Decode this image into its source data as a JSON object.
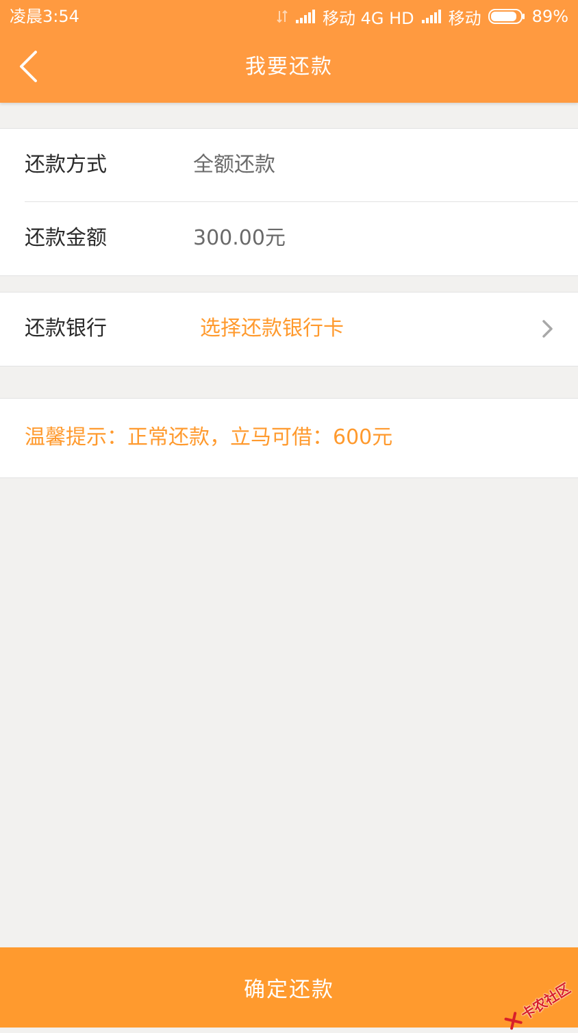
{
  "status_bar": {
    "time": "凌晨3:54",
    "carrier1": "移动 4G HD",
    "carrier2": "移动",
    "battery": "89%",
    "battery_level": 0.89
  },
  "header": {
    "title": "我要还款",
    "back_icon": "chevron-left-icon"
  },
  "repay_info": {
    "method_label": "还款方式",
    "method_value": "全额还款",
    "amount_label": "还款金额",
    "amount_value": "300.00元"
  },
  "bank": {
    "label": "还款银行",
    "placeholder": "选择还款银行卡",
    "arrow_icon": "chevron-right-icon"
  },
  "tip": {
    "text": "温馨提示：正常还款，立马可借：600元"
  },
  "footer": {
    "confirm_label": "确定还款"
  },
  "watermark": {
    "text": "卡农社区"
  },
  "colors": {
    "accent": "#ff9a40",
    "accent_text": "#ff9a2e",
    "background": "#f2f1ef"
  }
}
